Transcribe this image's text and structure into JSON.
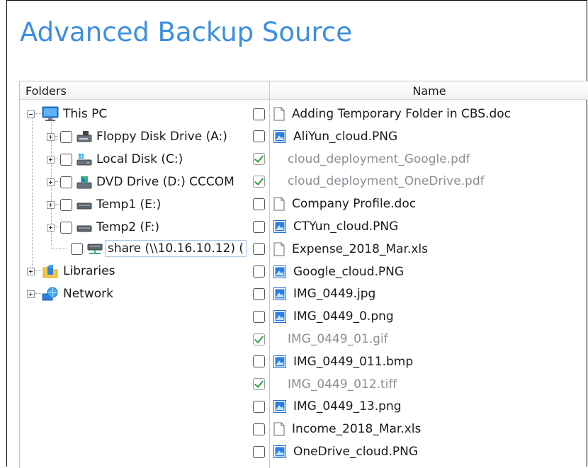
{
  "title": "Advanced Backup Source",
  "headers": {
    "folders": "Folders",
    "name": "Name"
  },
  "tree": {
    "root": "This PC",
    "drives": [
      "Floppy Disk Drive (A:)",
      "Local Disk (C:)",
      "DVD Drive (D:) CCCOM",
      "Temp1 (E:)",
      "Temp2 (F:)",
      "share (\\\\10.16.10.12) ("
    ],
    "libraries": "Libraries",
    "network": "Network"
  },
  "files": [
    {
      "name": "Adding Temporary Folder in CBS.doc",
      "type": "doc",
      "checked": false
    },
    {
      "name": "AliYun_cloud.PNG",
      "type": "img",
      "checked": false
    },
    {
      "name": "cloud_deployment_Google.pdf",
      "type": "none",
      "checked": true
    },
    {
      "name": "cloud_deployment_OneDrive.pdf",
      "type": "none",
      "checked": true
    },
    {
      "name": "Company Profile.doc",
      "type": "doc",
      "checked": false
    },
    {
      "name": "CTYun_cloud.PNG",
      "type": "img",
      "checked": false
    },
    {
      "name": "Expense_2018_Mar.xls",
      "type": "doc",
      "checked": false
    },
    {
      "name": "Google_cloud.PNG",
      "type": "img",
      "checked": false
    },
    {
      "name": "IMG_0449.jpg",
      "type": "img",
      "checked": false
    },
    {
      "name": "IMG_0449_0.png",
      "type": "img",
      "checked": false
    },
    {
      "name": "IMG_0449_01.gif",
      "type": "none",
      "checked": true
    },
    {
      "name": "IMG_0449_011.bmp",
      "type": "img",
      "checked": false
    },
    {
      "name": "IMG_0449_012.tiff",
      "type": "none",
      "checked": true
    },
    {
      "name": "IMG_0449_13.png",
      "type": "img",
      "checked": false
    },
    {
      "name": "Income_2018_Mar.xls",
      "type": "doc",
      "checked": false
    },
    {
      "name": "OneDrive_cloud.PNG",
      "type": "img",
      "checked": false
    }
  ],
  "colors": {
    "title": "#3d8fe0",
    "check": "#2ea043",
    "dim_text": "#8a8f95"
  }
}
